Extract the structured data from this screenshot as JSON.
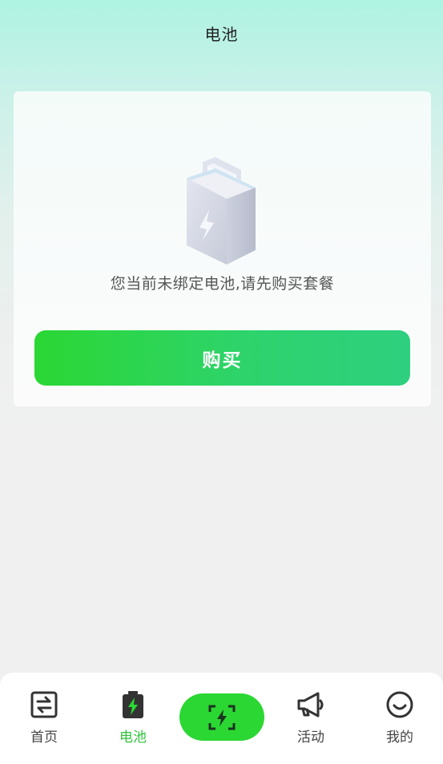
{
  "header": {
    "title": "电池"
  },
  "card": {
    "empty_message": "您当前未绑定电池,请先购买套餐",
    "buy_label": "购买"
  },
  "tabbar": {
    "items": [
      {
        "label": "首页",
        "icon": "swap-icon",
        "active": false
      },
      {
        "label": "电池",
        "icon": "battery-icon",
        "active": true
      },
      {
        "label": "活动",
        "icon": "megaphone-icon",
        "active": false
      },
      {
        "label": "我的",
        "icon": "smile-icon",
        "active": false
      }
    ],
    "scan_icon": "scan-charge-icon"
  },
  "colors": {
    "accent": "#2bd733",
    "active_tab": "#2dc63a",
    "header_gradient_top": "#aef3e2",
    "background": "#f0f0f0"
  }
}
